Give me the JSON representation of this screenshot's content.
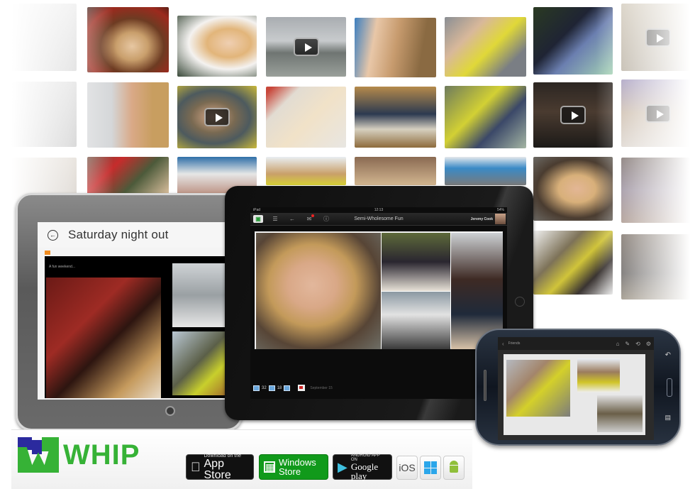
{
  "brand": {
    "name": "WHIP",
    "logo_color": "#36b236",
    "logo_accent": "#2b2a9e"
  },
  "photo_wall": {
    "tiles": [
      {
        "row": 1,
        "col": 1,
        "faded": true,
        "video": false
      },
      {
        "row": 1,
        "col": 2,
        "faded": false,
        "video": false
      },
      {
        "row": 1,
        "col": 3,
        "faded": false,
        "video": false
      },
      {
        "row": 1,
        "col": 4,
        "faded": false,
        "video": true
      },
      {
        "row": 1,
        "col": 5,
        "faded": false,
        "video": false
      },
      {
        "row": 1,
        "col": 6,
        "faded": false,
        "video": false
      },
      {
        "row": 1,
        "col": 7,
        "faded": false,
        "video": false
      },
      {
        "row": 1,
        "col": 8,
        "faded": true,
        "video": true
      },
      {
        "row": 2,
        "col": 1,
        "faded": true,
        "video": false
      },
      {
        "row": 2,
        "col": 2,
        "faded": false,
        "video": false
      },
      {
        "row": 2,
        "col": 3,
        "faded": false,
        "video": true
      },
      {
        "row": 2,
        "col": 4,
        "faded": false,
        "video": false
      },
      {
        "row": 2,
        "col": 5,
        "faded": false,
        "video": false
      },
      {
        "row": 2,
        "col": 6,
        "faded": false,
        "video": false
      },
      {
        "row": 2,
        "col": 7,
        "faded": false,
        "video": true
      },
      {
        "row": 2,
        "col": 8,
        "faded": true,
        "video": true
      },
      {
        "row": 3,
        "col": 7,
        "faded": false,
        "video": false
      },
      {
        "row": 3,
        "col": 8,
        "faded": true,
        "video": false
      },
      {
        "row": 4,
        "col": 7,
        "faded": false,
        "video": false
      },
      {
        "row": 4,
        "col": 8,
        "faded": true,
        "video": false
      }
    ]
  },
  "windows_tablet": {
    "album_title": "Saturday night out",
    "caption": "A fun weekend...",
    "back_icon": "back-arrow-icon"
  },
  "ipad": {
    "status_left": "iPad",
    "status_time": "12:13",
    "status_right": "54%",
    "album_title": "Semi-Wholesome Fun",
    "user_name": "Jeremy Cook",
    "toolbar_icons": [
      "album-icon",
      "list-icon",
      "back-arrow-icon",
      "notifications-icon",
      "info-icon"
    ],
    "photo_count": "32",
    "video_count": "18",
    "date_label": "September 15"
  },
  "phone": {
    "screen_title": "Friends",
    "toolbar_icons": [
      "home-icon",
      "edit-icon",
      "share-icon",
      "settings-icon"
    ]
  },
  "stores": {
    "app_store": {
      "small": "Download on the",
      "big": "App Store"
    },
    "windows_store": {
      "small": "Windows",
      "big": "Store"
    },
    "google_play": {
      "small": "ANDROID APP ON",
      "big": "Google play"
    },
    "platforms": [
      "iOS",
      "Windows",
      "Android"
    ],
    "ios_label": "iOS"
  }
}
